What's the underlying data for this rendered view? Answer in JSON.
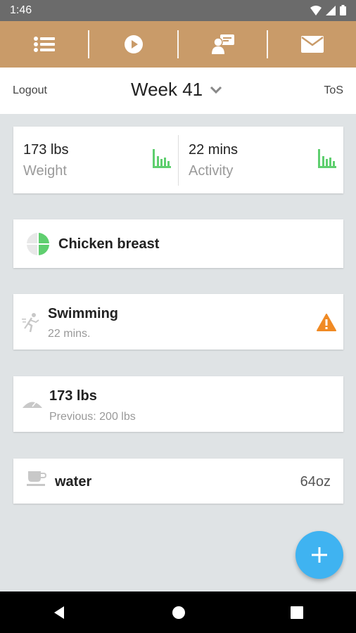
{
  "status_bar": {
    "time": "1:46"
  },
  "toolbar": {
    "items": [
      "list-icon",
      "play-icon",
      "contacts-icon",
      "mail-icon"
    ]
  },
  "week_bar": {
    "logout_label": "Logout",
    "week_label": "Week 41",
    "tos_label": "ToS"
  },
  "stats": {
    "weight": {
      "value": "173 lbs",
      "label": "Weight"
    },
    "activity": {
      "value": "22 mins",
      "label": "Activity"
    }
  },
  "food": {
    "title": "Chicken breast"
  },
  "exercise": {
    "title": "Swimming",
    "subtitle": "22 mins."
  },
  "weigh_in": {
    "title": "173 lbs",
    "subtitle": "Previous: 200 lbs"
  },
  "water": {
    "title": "water",
    "amount": "64oz"
  },
  "colors": {
    "toolbar": "#c99b69",
    "accent_green": "#5fcf6f",
    "warning": "#f08a24",
    "fab": "#3fb3f1"
  }
}
